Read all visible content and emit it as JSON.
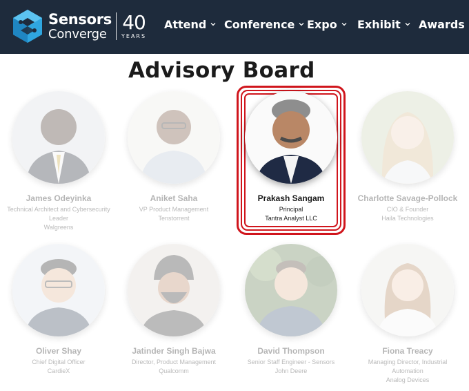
{
  "header": {
    "logo": {
      "line1": "Sensors",
      "line2": "Converge",
      "anniversary_number": "40",
      "anniversary_label": "YEARS"
    },
    "nav": [
      {
        "label": "Attend",
        "has_dropdown": true
      },
      {
        "label": "Conference",
        "has_dropdown": true
      },
      {
        "label": "Expo",
        "has_dropdown": true
      },
      {
        "label": "Exhibit",
        "has_dropdown": true
      },
      {
        "label": "Awards",
        "has_dropdown": false
      }
    ]
  },
  "page": {
    "title": "Advisory Board"
  },
  "board": [
    {
      "name": "James Odeyinka",
      "lines": [
        "Technical Architect and Cybersecurity",
        "Leader",
        "Walgreens"
      ],
      "highlighted": false
    },
    {
      "name": "Aniket Saha",
      "lines": [
        "VP Product Management",
        "Tenstorrent"
      ],
      "highlighted": false
    },
    {
      "name": "Prakash Sangam",
      "lines": [
        "Principal",
        "Tantra Analyst LLC"
      ],
      "highlighted": true
    },
    {
      "name": "Charlotte Savage-Pollock",
      "lines": [
        "CIO & Founder",
        "Haila Technologies"
      ],
      "highlighted": false
    },
    {
      "name": "Oliver Shay",
      "lines": [
        "Chief Digital Officer",
        "CardieX"
      ],
      "highlighted": false
    },
    {
      "name": "Jatinder Singh Bajwa",
      "lines": [
        "Director, Product Management",
        "Qualcomm"
      ],
      "highlighted": false
    },
    {
      "name": "David Thompson",
      "lines": [
        "Senior Staff Engineer - Sensors",
        "John Deere"
      ],
      "highlighted": false
    },
    {
      "name": "Fiona Treacy",
      "lines": [
        "Managing Director, Industrial",
        "Automation",
        "Analog Devices"
      ],
      "highlighted": false
    }
  ],
  "colors": {
    "header_bg": "#1e2b3c",
    "highlight_border": "#d0151c",
    "logo_accent": "#2fa6e0"
  }
}
